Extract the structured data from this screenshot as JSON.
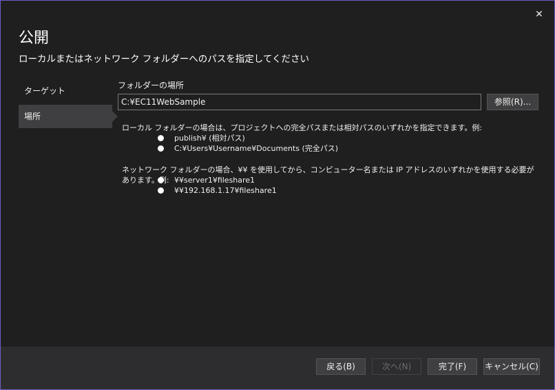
{
  "dialog": {
    "title": "公開",
    "subtitle": "ローカルまたはネットワーク フォルダーへのパスを指定してください",
    "close_glyph": "✕"
  },
  "sidebar": {
    "items": [
      {
        "label": "ターゲット",
        "selected": false
      },
      {
        "label": "場所",
        "selected": true
      }
    ]
  },
  "location": {
    "field_label": "フォルダーの場所",
    "path_value": "C:¥EC11WebSample",
    "browse_label": "参照(R)..."
  },
  "help": {
    "local_intro": "ローカル フォルダーの場合は、プロジェクトへの完全パスまたは相対パスのいずれかを指定できます。例:",
    "local_examples": [
      "publish¥ (相対パス)",
      "C:¥Users¥Username¥Documents (完全パス)"
    ],
    "network_intro": "ネットワーク フォルダーの場合、¥¥ を使用してから、コンピューター名または IP アドレスのいずれかを使用する必要があります。例:",
    "network_examples": [
      "¥¥server1¥fileshare1",
      "¥¥192.168.1.17¥fileshare1"
    ]
  },
  "footer": {
    "back_label": "戻る(B)",
    "next_label": "次へ(N)",
    "finish_label": "完了(F)",
    "cancel_label": "キャンセル(C)"
  },
  "colors": {
    "background": "#1f1f1f",
    "footer": "#2d2d30",
    "selected": "#3f3f41",
    "border_accent": "#6c5fc7"
  }
}
